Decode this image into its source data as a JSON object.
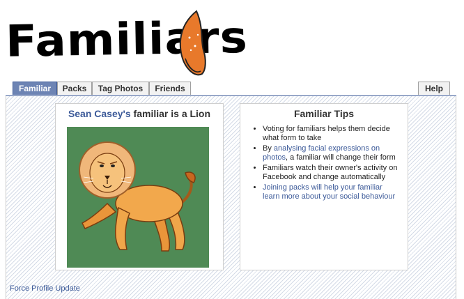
{
  "logo": {
    "text": "Familiars",
    "tail_color": "#e8792b"
  },
  "tabs": [
    {
      "label": "Familiar",
      "active": true
    },
    {
      "label": "Packs",
      "active": false
    },
    {
      "label": "Tag Photos",
      "active": false
    },
    {
      "label": "Friends",
      "active": false
    }
  ],
  "help_tab": {
    "label": "Help"
  },
  "familiar_card": {
    "owner_name": "Sean Casey's",
    "title_suffix": " familiar is a Lion",
    "image_icon": "lion-illustration",
    "background_color": "#4f8a55"
  },
  "tips_card": {
    "title": "Familiar Tips",
    "tip1": "Voting for familiars helps them decide what form to take",
    "tip2_prefix": "By ",
    "tip2_link": "analysing facial expressions on photos",
    "tip2_suffix": ", a familiar will change their form",
    "tip3": "Familiars watch their owner's activity on Facebook and change automatically",
    "tip4_link": "Joining packs will help your familiar learn more about your social behaviour"
  },
  "footer": {
    "force_update": "Force Profile Update"
  },
  "colors": {
    "link": "#3b5998",
    "active_tab": "#6d84b4"
  }
}
